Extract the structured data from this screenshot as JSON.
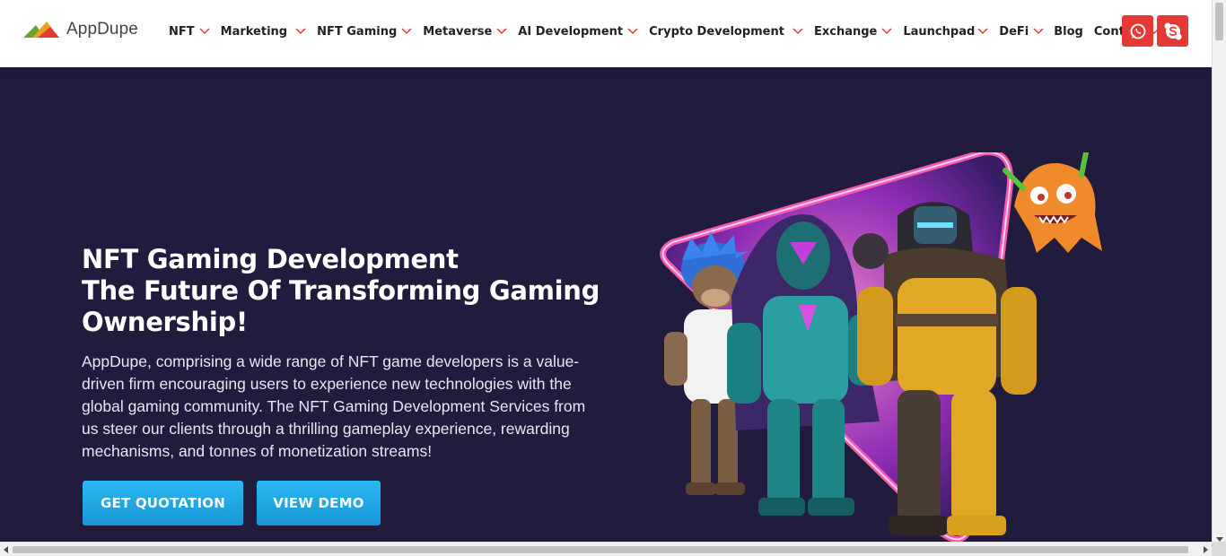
{
  "header": {
    "logo_text": "AppDupe",
    "nav": [
      {
        "label": "NFT",
        "dropdown": true
      },
      {
        "label": "Marketing",
        "dropdown": true
      },
      {
        "label": "NFT Gaming",
        "dropdown": true
      },
      {
        "label": "Metaverse",
        "dropdown": true
      },
      {
        "label": "AI Development",
        "dropdown": true
      },
      {
        "label": "Crypto Development",
        "dropdown": true
      },
      {
        "label": "Exchange",
        "dropdown": true
      },
      {
        "label": "Launchpad",
        "dropdown": true
      },
      {
        "label": "DeFi",
        "dropdown": true
      },
      {
        "label": "Blog",
        "dropdown": false
      },
      {
        "label": "Contact",
        "dropdown": true
      }
    ],
    "contact_icons": [
      "whatsapp-icon",
      "skype-icon"
    ]
  },
  "hero": {
    "title_line1": "NFT Gaming Development",
    "title_line2": "The Future Of Transforming Gaming",
    "title_line3": "Ownership!",
    "description": "AppDupe, comprising a wide range of NFT game developers is a value-driven firm encouraging users to experience new technologies with the global gaming community. The NFT Gaming Development Services from us steer our clients through a thrilling gameplay experience, rewarding mechanisms, and tonnes of monetization streams!",
    "quote_button": "GET QUOTATION",
    "demo_button": "VIEW DEMO"
  },
  "colors": {
    "hero_bg": "#211b3d",
    "accent_red": "#e53935",
    "button_blue": "#1fa6e4",
    "nav_chevron": "#e53935"
  }
}
